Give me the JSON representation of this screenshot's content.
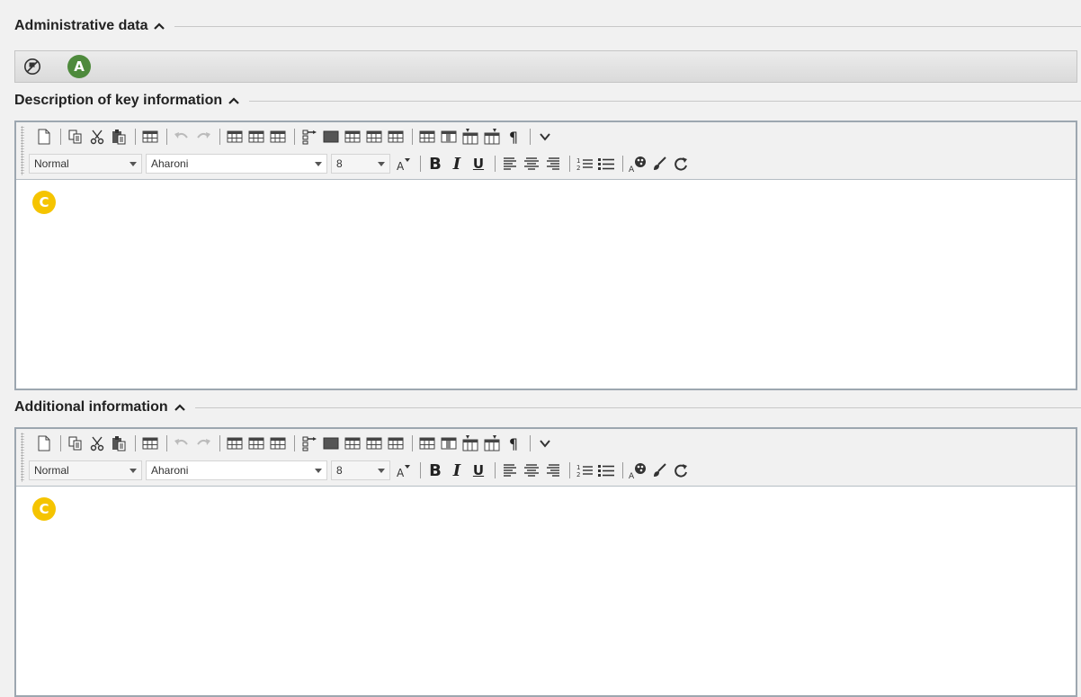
{
  "sections": {
    "administrative": {
      "title": "Administrative data",
      "badge": "A"
    },
    "description": {
      "title": "Description of key information",
      "badge": "C"
    },
    "additional": {
      "title": "Additional information",
      "badge": "C"
    }
  },
  "toolbar": {
    "style_select": "Normal",
    "font_select": "Aharoni",
    "size_select": "8",
    "bold": "B",
    "italic": "I",
    "underline": "U",
    "pilcrow": "¶"
  },
  "colors": {
    "badge_green": "#4e8a3c",
    "badge_yellow": "#f5c400",
    "editor_border": "#9da7b0"
  },
  "icons": {
    "row1": [
      "new-document-icon",
      "copy-icon",
      "cut-icon",
      "paste-icon",
      "table-icon",
      "undo-icon",
      "redo-icon",
      "insert-row-icon",
      "insert-column-icon",
      "merge-cells-icon",
      "outline-icon",
      "table-style-1-icon",
      "table-style-2-icon",
      "table-style-3-icon",
      "table-style-4-icon",
      "table-props-icon",
      "cell-props-icon",
      "insert-column-left-icon",
      "insert-column-right-icon",
      "show-formatting-icon",
      "more-icon"
    ],
    "row2": [
      "font-size-icon",
      "bold-icon",
      "italic-icon",
      "underline-icon",
      "align-left-icon",
      "align-center-icon",
      "align-right-icon",
      "numbered-list-icon",
      "bulleted-list-icon",
      "text-color-icon",
      "format-painter-icon",
      "refresh-icon"
    ]
  }
}
